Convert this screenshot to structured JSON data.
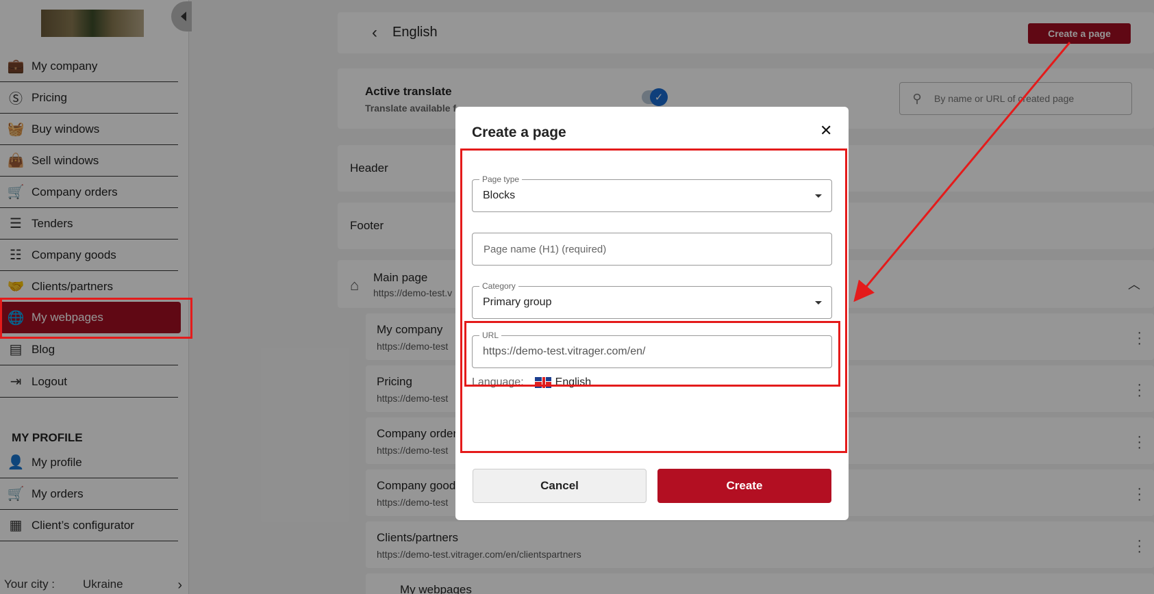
{
  "sidebar": {
    "items": [
      {
        "label": "My company",
        "icon": "briefcase-icon"
      },
      {
        "label": "Pricing",
        "icon": "dollar-icon"
      },
      {
        "label": "Buy windows",
        "icon": "basket-icon"
      },
      {
        "label": "Sell windows",
        "icon": "bag-dollar-icon"
      },
      {
        "label": "Company orders",
        "icon": "cart-icon"
      },
      {
        "label": "Tenders",
        "icon": "list-icon"
      },
      {
        "label": "Company goods",
        "icon": "grid-list-icon"
      },
      {
        "label": "Clients/partners",
        "icon": "handshake-icon"
      },
      {
        "label": "My webpages",
        "icon": "globe-icon"
      },
      {
        "label": "Blog",
        "icon": "blog-icon"
      },
      {
        "label": "Logout",
        "icon": "logout-icon"
      }
    ],
    "profile_heading": "MY PROFILE",
    "profile_items": [
      {
        "label": "My profile",
        "icon": "user-icon"
      },
      {
        "label": "My orders",
        "icon": "cart-icon"
      },
      {
        "label": "Client’s configurator",
        "icon": "calculator-icon"
      }
    ],
    "city_label": "Your city :",
    "city_value": "Ukraine"
  },
  "header": {
    "title": "English",
    "create_button": "Create a page"
  },
  "translate": {
    "title": "Active translate",
    "subtitle": "Translate available f",
    "search_placeholder": "By name or URL of created page"
  },
  "sections": {
    "header_label": "Header",
    "footer_label": "Footer"
  },
  "main_page": {
    "title": "Main page",
    "url": "https://demo-test.v"
  },
  "pages": [
    {
      "title": "My company",
      "url": "https://demo-test"
    },
    {
      "title": "Pricing",
      "url": "https://demo-test"
    },
    {
      "title": "Company orders",
      "url": "https://demo-test"
    },
    {
      "title": "Company goods",
      "url": "https://demo-test"
    },
    {
      "title": "Clients/partners",
      "url": "https://demo-test.vitrager.com/en/clientspartners"
    },
    {
      "title": "My webpages",
      "url": ""
    }
  ],
  "dialog": {
    "title": "Create a page",
    "page_type_legend": "Page type",
    "page_type_value": "Blocks",
    "page_name_placeholder": "Page name (H1) (required)",
    "category_legend": "Category",
    "category_value": "Primary group",
    "url_legend": "URL",
    "url_value": "https://demo-test.vitrager.com/en/",
    "language_label": "Language:",
    "language_value": "English",
    "cancel_label": "Cancel",
    "create_label": "Create"
  },
  "colors": {
    "brand": "#a30f22",
    "annotation": "#e41b1b",
    "toggle": "#1a6bd1"
  }
}
